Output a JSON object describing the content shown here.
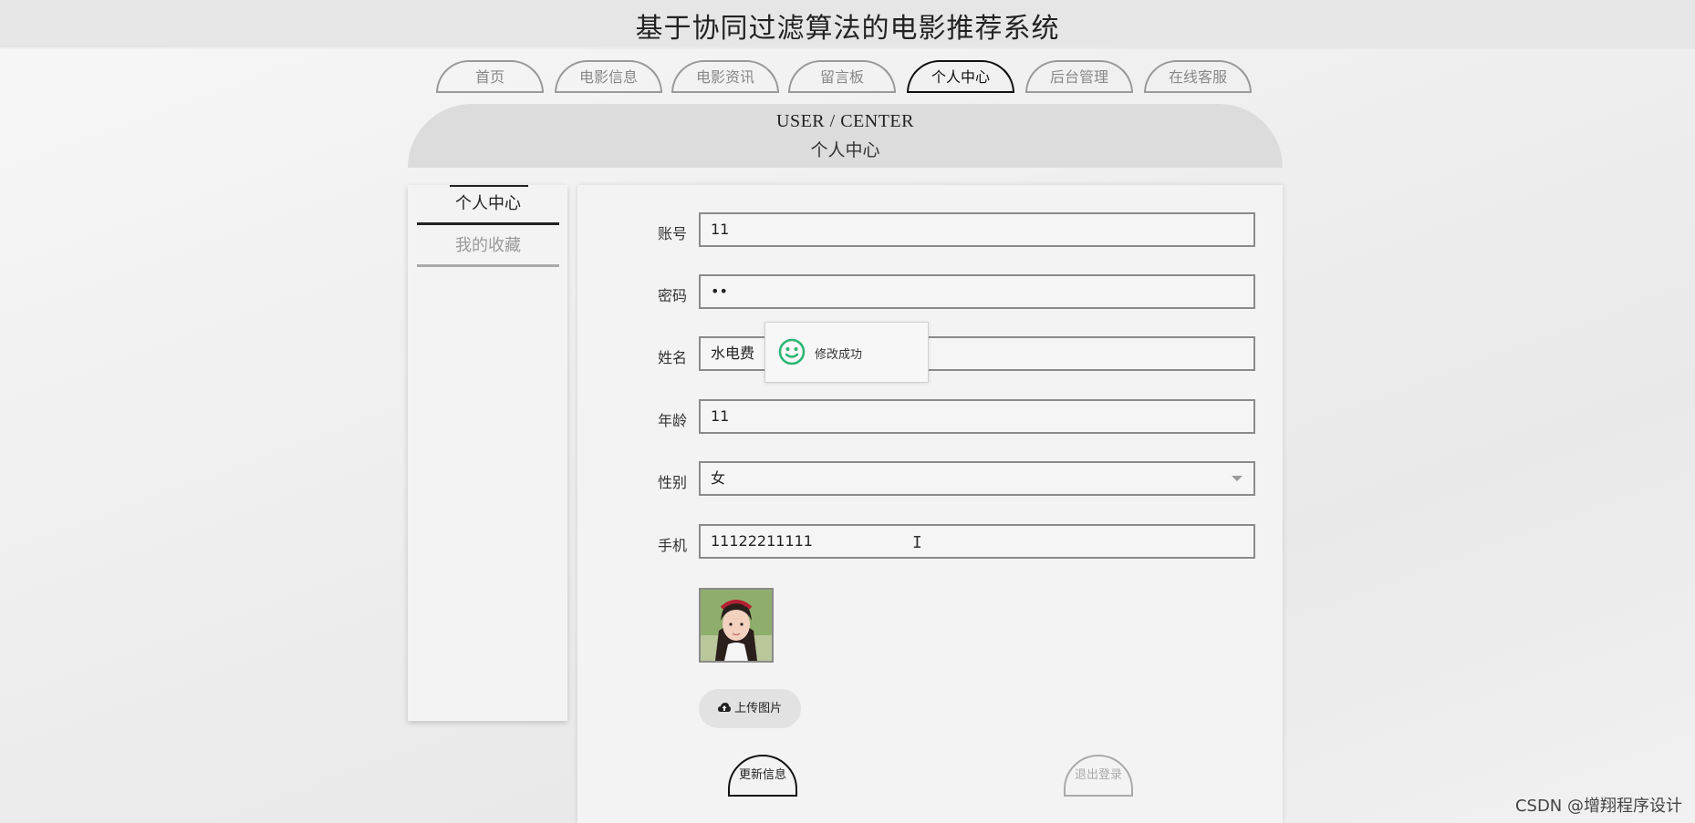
{
  "header": {
    "title": "基于协同过滤算法的电影推荐系统"
  },
  "nav": {
    "tabs": [
      {
        "label": "首页",
        "active": false
      },
      {
        "label": "电影信息",
        "active": false
      },
      {
        "label": "电影资讯",
        "active": false
      },
      {
        "label": "留言板",
        "active": false
      },
      {
        "label": "个人中心",
        "active": true
      },
      {
        "label": "后台管理",
        "active": false
      },
      {
        "label": "在线客服",
        "active": false
      }
    ]
  },
  "section": {
    "title_en": "USER / CENTER",
    "title_cn": "个人中心"
  },
  "sidebar": {
    "items": [
      {
        "label": "个人中心",
        "active": true
      },
      {
        "label": "我的收藏",
        "active": false
      }
    ]
  },
  "form": {
    "account": {
      "label": "账号",
      "value": "11"
    },
    "password": {
      "label": "密码",
      "value": "••"
    },
    "name": {
      "label": "姓名",
      "value": "水电费"
    },
    "age": {
      "label": "年龄",
      "value": "11"
    },
    "gender": {
      "label": "性别",
      "value": "女"
    },
    "phone": {
      "label": "手机",
      "value": "11122211111"
    },
    "upload_label": "上传图片",
    "update_label": "更新信息",
    "logout_label": "退出登录"
  },
  "toast": {
    "message": "修改成功",
    "icon": "smile-icon",
    "color": "#2bb673"
  },
  "watermark": {
    "text": "CSDN @增翔程序设计"
  }
}
